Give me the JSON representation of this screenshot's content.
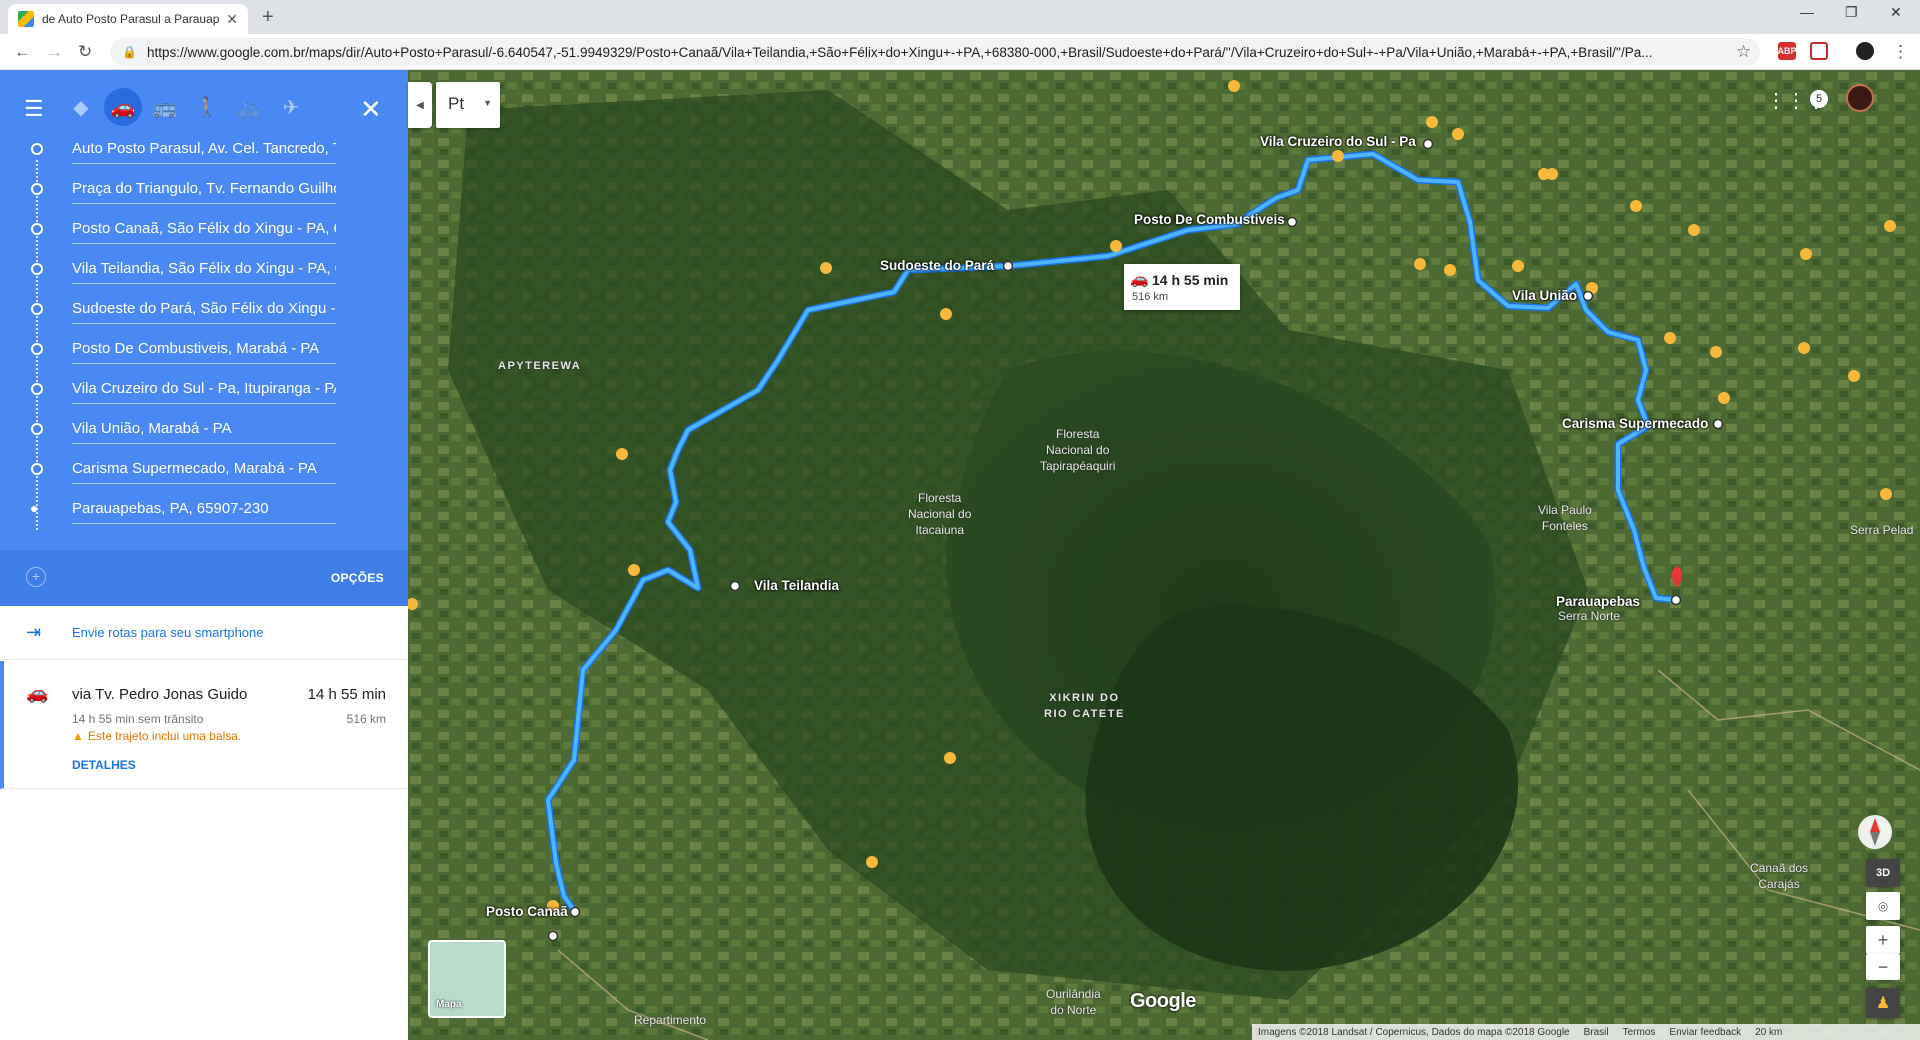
{
  "browser": {
    "tab_title": "de Auto Posto Parasul a Parauap",
    "url": "https://www.google.com.br/maps/dir/Auto+Posto+Parasul/-6.640547,-51.9949329/Posto+Canaã/Vila+Teilandia,+São+Félix+do+Xingu+-+PA,+68380-000,+Brasil/Sudoeste+do+Pará/''/Vila+Cruzeiro+do+Sul+-+Pa/Vila+União,+Marabá+-+PA,+Brasil/''/Pa...",
    "ext_abp": "ABP"
  },
  "panel": {
    "stops": [
      "Auto Posto Parasul, Av. Cel. Tancredo, T",
      "Praça do Triangulo, Tv. Fernando Guilho",
      "Posto Canaã, São Félix do Xingu - PA, 6",
      "Vila Teilandia, São Félix do Xingu - PA, 6",
      "Sudoeste do Pará, São Félix do Xingu - P",
      "Posto De Combustiveis, Marabá - PA",
      "Vila Cruzeiro do Sul - Pa, Itupiranga - PA",
      "Vila União, Marabá - PA",
      "Carisma Supermecado, Marabá - PA",
      "Parauapebas, PA, 65907-230"
    ],
    "options_label": "OPÇÕES",
    "send_label": "Envie rotas para seu smartphone",
    "route": {
      "via": "via Tv. Pedro Jonas Guido",
      "time": "14 h 55 min",
      "sub": "14 h 55 min sem trânsito",
      "distance": "516 km",
      "warning": "Este trajeto inclui uma balsa.",
      "details": "DETALHES"
    }
  },
  "map": {
    "lang": "Pt",
    "time_box": {
      "time": "14 h 55 min",
      "distance": "516 km"
    },
    "labels": {
      "posto_canaa": "Posto Canaã",
      "vila_teilandia": "Vila Teilandia",
      "sudoeste": "Sudoeste do Pará",
      "posto_comb": "Posto De Combustiveis",
      "vila_cruzeiro": "Vila Cruzeiro do Sul - Pa",
      "vila_uniao": "Vila União",
      "carisma": "Carisma Supermecado",
      "parauapebas": "Parauapebas"
    },
    "areas": {
      "apyterewa": "APYTEREWA",
      "tapirapeaquiri": "Floresta\nNacional do\nTapirapéaquiri",
      "itacaiuna": "Floresta\nNacional do\nItacaiuna",
      "xikrin": "XIKRIN DO\nRIO CATETE",
      "vila_paulo": "Vila Paulo\nFonteles",
      "serra_norte": "Serra Norte",
      "serra_pelada": "Serra Pelad",
      "canaa_carajas": "Canaã dos\nCarajás",
      "ourilandia": "Ourilândia\ndo Norte",
      "repartimento": "Repartimento"
    },
    "apps_count": "5",
    "minimap_label": "Mapa",
    "google": "Google",
    "footer": [
      "Imagens ©2018 Landsat / Copernicus, Dados do mapa ©2018 Google",
      "Brasil",
      "Termos",
      "Enviar feedback",
      "20 km"
    ],
    "ctl_3d": "3D"
  }
}
